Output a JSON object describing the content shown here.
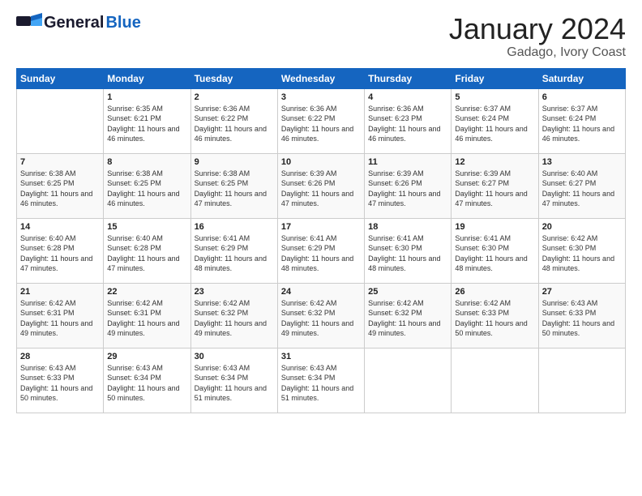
{
  "header": {
    "logo_general": "General",
    "logo_blue": "Blue",
    "title": "January 2024",
    "subtitle": "Gadago, Ivory Coast"
  },
  "weekdays": [
    "Sunday",
    "Monday",
    "Tuesday",
    "Wednesday",
    "Thursday",
    "Friday",
    "Saturday"
  ],
  "weeks": [
    [
      {
        "day": "",
        "sunrise": "",
        "sunset": "",
        "daylight": ""
      },
      {
        "day": "1",
        "sunrise": "Sunrise: 6:35 AM",
        "sunset": "Sunset: 6:21 PM",
        "daylight": "Daylight: 11 hours and 46 minutes."
      },
      {
        "day": "2",
        "sunrise": "Sunrise: 6:36 AM",
        "sunset": "Sunset: 6:22 PM",
        "daylight": "Daylight: 11 hours and 46 minutes."
      },
      {
        "day": "3",
        "sunrise": "Sunrise: 6:36 AM",
        "sunset": "Sunset: 6:22 PM",
        "daylight": "Daylight: 11 hours and 46 minutes."
      },
      {
        "day": "4",
        "sunrise": "Sunrise: 6:36 AM",
        "sunset": "Sunset: 6:23 PM",
        "daylight": "Daylight: 11 hours and 46 minutes."
      },
      {
        "day": "5",
        "sunrise": "Sunrise: 6:37 AM",
        "sunset": "Sunset: 6:24 PM",
        "daylight": "Daylight: 11 hours and 46 minutes."
      },
      {
        "day": "6",
        "sunrise": "Sunrise: 6:37 AM",
        "sunset": "Sunset: 6:24 PM",
        "daylight": "Daylight: 11 hours and 46 minutes."
      }
    ],
    [
      {
        "day": "7",
        "sunrise": "Sunrise: 6:38 AM",
        "sunset": "Sunset: 6:25 PM",
        "daylight": "Daylight: 11 hours and 46 minutes."
      },
      {
        "day": "8",
        "sunrise": "Sunrise: 6:38 AM",
        "sunset": "Sunset: 6:25 PM",
        "daylight": "Daylight: 11 hours and 46 minutes."
      },
      {
        "day": "9",
        "sunrise": "Sunrise: 6:38 AM",
        "sunset": "Sunset: 6:25 PM",
        "daylight": "Daylight: 11 hours and 47 minutes."
      },
      {
        "day": "10",
        "sunrise": "Sunrise: 6:39 AM",
        "sunset": "Sunset: 6:26 PM",
        "daylight": "Daylight: 11 hours and 47 minutes."
      },
      {
        "day": "11",
        "sunrise": "Sunrise: 6:39 AM",
        "sunset": "Sunset: 6:26 PM",
        "daylight": "Daylight: 11 hours and 47 minutes."
      },
      {
        "day": "12",
        "sunrise": "Sunrise: 6:39 AM",
        "sunset": "Sunset: 6:27 PM",
        "daylight": "Daylight: 11 hours and 47 minutes."
      },
      {
        "day": "13",
        "sunrise": "Sunrise: 6:40 AM",
        "sunset": "Sunset: 6:27 PM",
        "daylight": "Daylight: 11 hours and 47 minutes."
      }
    ],
    [
      {
        "day": "14",
        "sunrise": "Sunrise: 6:40 AM",
        "sunset": "Sunset: 6:28 PM",
        "daylight": "Daylight: 11 hours and 47 minutes."
      },
      {
        "day": "15",
        "sunrise": "Sunrise: 6:40 AM",
        "sunset": "Sunset: 6:28 PM",
        "daylight": "Daylight: 11 hours and 47 minutes."
      },
      {
        "day": "16",
        "sunrise": "Sunrise: 6:41 AM",
        "sunset": "Sunset: 6:29 PM",
        "daylight": "Daylight: 11 hours and 48 minutes."
      },
      {
        "day": "17",
        "sunrise": "Sunrise: 6:41 AM",
        "sunset": "Sunset: 6:29 PM",
        "daylight": "Daylight: 11 hours and 48 minutes."
      },
      {
        "day": "18",
        "sunrise": "Sunrise: 6:41 AM",
        "sunset": "Sunset: 6:30 PM",
        "daylight": "Daylight: 11 hours and 48 minutes."
      },
      {
        "day": "19",
        "sunrise": "Sunrise: 6:41 AM",
        "sunset": "Sunset: 6:30 PM",
        "daylight": "Daylight: 11 hours and 48 minutes."
      },
      {
        "day": "20",
        "sunrise": "Sunrise: 6:42 AM",
        "sunset": "Sunset: 6:30 PM",
        "daylight": "Daylight: 11 hours and 48 minutes."
      }
    ],
    [
      {
        "day": "21",
        "sunrise": "Sunrise: 6:42 AM",
        "sunset": "Sunset: 6:31 PM",
        "daylight": "Daylight: 11 hours and 49 minutes."
      },
      {
        "day": "22",
        "sunrise": "Sunrise: 6:42 AM",
        "sunset": "Sunset: 6:31 PM",
        "daylight": "Daylight: 11 hours and 49 minutes."
      },
      {
        "day": "23",
        "sunrise": "Sunrise: 6:42 AM",
        "sunset": "Sunset: 6:32 PM",
        "daylight": "Daylight: 11 hours and 49 minutes."
      },
      {
        "day": "24",
        "sunrise": "Sunrise: 6:42 AM",
        "sunset": "Sunset: 6:32 PM",
        "daylight": "Daylight: 11 hours and 49 minutes."
      },
      {
        "day": "25",
        "sunrise": "Sunrise: 6:42 AM",
        "sunset": "Sunset: 6:32 PM",
        "daylight": "Daylight: 11 hours and 49 minutes."
      },
      {
        "day": "26",
        "sunrise": "Sunrise: 6:42 AM",
        "sunset": "Sunset: 6:33 PM",
        "daylight": "Daylight: 11 hours and 50 minutes."
      },
      {
        "day": "27",
        "sunrise": "Sunrise: 6:43 AM",
        "sunset": "Sunset: 6:33 PM",
        "daylight": "Daylight: 11 hours and 50 minutes."
      }
    ],
    [
      {
        "day": "28",
        "sunrise": "Sunrise: 6:43 AM",
        "sunset": "Sunset: 6:33 PM",
        "daylight": "Daylight: 11 hours and 50 minutes."
      },
      {
        "day": "29",
        "sunrise": "Sunrise: 6:43 AM",
        "sunset": "Sunset: 6:34 PM",
        "daylight": "Daylight: 11 hours and 50 minutes."
      },
      {
        "day": "30",
        "sunrise": "Sunrise: 6:43 AM",
        "sunset": "Sunset: 6:34 PM",
        "daylight": "Daylight: 11 hours and 51 minutes."
      },
      {
        "day": "31",
        "sunrise": "Sunrise: 6:43 AM",
        "sunset": "Sunset: 6:34 PM",
        "daylight": "Daylight: 11 hours and 51 minutes."
      },
      {
        "day": "",
        "sunrise": "",
        "sunset": "",
        "daylight": ""
      },
      {
        "day": "",
        "sunrise": "",
        "sunset": "",
        "daylight": ""
      },
      {
        "day": "",
        "sunrise": "",
        "sunset": "",
        "daylight": ""
      }
    ]
  ]
}
